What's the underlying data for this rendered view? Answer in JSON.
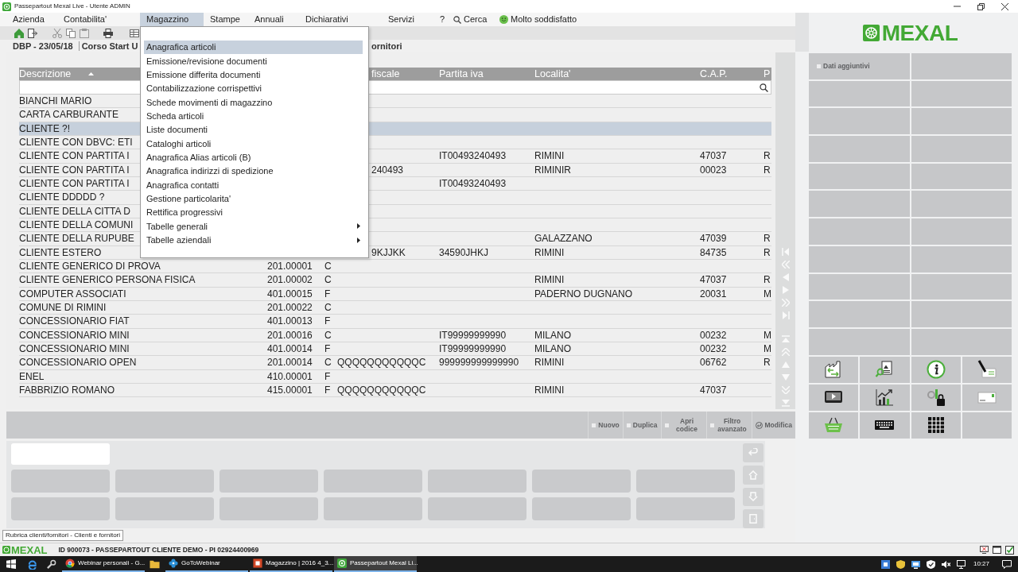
{
  "window": {
    "title": "Passepartout Mexal Live - Utente ADMIN"
  },
  "menu_bar": [
    {
      "label": "Azienda",
      "kind": "menu",
      "selected": false
    },
    {
      "label": "Contabilita'",
      "kind": "menu",
      "selected": false
    },
    {
      "label": "Magazzino",
      "kind": "menu",
      "selected": true
    },
    {
      "label": "Stampe",
      "kind": "menu",
      "selected": false
    },
    {
      "label": "Annuali",
      "kind": "menu",
      "selected": false
    },
    {
      "label": "Dichiarativi",
      "kind": "menu",
      "selected": false
    },
    {
      "label": "Servizi",
      "kind": "menu",
      "selected": false
    },
    {
      "label": "?",
      "kind": "menu",
      "selected": false
    },
    {
      "label": "Cerca",
      "kind": "search",
      "selected": false
    },
    {
      "label": "Molto soddisfatto",
      "kind": "feedback",
      "selected": false
    }
  ],
  "breadcrumb": {
    "context": "DBP - 23/05/18",
    "title_left_part": "Corso Start U",
    "title_right_part": "ornitori"
  },
  "table": {
    "columns": {
      "descrizione": {
        "label": "Descrizione",
        "sort_ascending": true
      },
      "fiscale": {
        "label": "fiscale"
      },
      "partita_iva": {
        "label": "Partita iva"
      },
      "localita": {
        "label": "Localita'"
      },
      "cap": {
        "label": "C.A.P."
      },
      "column_8": {
        "label": "P"
      }
    },
    "rows": [
      {
        "descrizione": "BIANCHI MARIO",
        "selected": false
      },
      {
        "descrizione": "CARTA CARBURANTE",
        "selected": false
      },
      {
        "descrizione": "CLIENTE ?!",
        "selected": true
      },
      {
        "descrizione": "CLIENTE CON DBVC: ETI",
        "selected": false
      },
      {
        "descrizione": "CLIENTE CON PARTITA I",
        "partita_iva": "IT00493240493",
        "localita": "RIMINI",
        "cap": "47037",
        "column_8": "R",
        "selected": false
      },
      {
        "descrizione": "CLIENTE CON PARTITA I",
        "fiscale": "240493",
        "localita": "RIMINIR",
        "cap": "00023",
        "column_8": "R",
        "selected": false
      },
      {
        "descrizione": "CLIENTE CON PARTITA I",
        "partita_iva": "IT00493240493",
        "selected": false
      },
      {
        "descrizione": "CLIENTE DDDDD ?",
        "selected": false
      },
      {
        "descrizione": "CLIENTE DELLA CITTA D",
        "selected": false
      },
      {
        "descrizione": "CLIENTE DELLA COMUNI",
        "selected": false
      },
      {
        "descrizione": "CLIENTE DELLA RUPUBE",
        "localita": "GALAZZANO",
        "cap": "47039",
        "column_8": "R",
        "selected": false
      },
      {
        "descrizione": "CLIENTE ESTERO",
        "fiscale": "9KJJKK",
        "partita_iva": "34590JHKJ",
        "localita": "RIMINI",
        "cap": "84735",
        "column_8": "R",
        "selected": false
      },
      {
        "descrizione": "CLIENTE GENERICO DI PROVA",
        "column_2": "201.00001",
        "column_3": "C",
        "selected": false
      },
      {
        "descrizione": "CLIENTE GENERICO PERSONA FISICA",
        "column_2": "201.00002",
        "column_3": "C",
        "localita": "RIMINI",
        "cap": "47037",
        "column_8": "R",
        "selected": false
      },
      {
        "descrizione": "COMPUTER ASSOCIATI",
        "column_2": "401.00015",
        "column_3": "F",
        "localita": "PADERNO DUGNANO",
        "cap": "20031",
        "column_8": "M",
        "selected": false
      },
      {
        "descrizione": "COMUNE DI RIMINI",
        "column_2": "201.00022",
        "column_3": "C",
        "selected": false
      },
      {
        "descrizione": "CONCESSIONARIO FIAT",
        "column_2": "401.00013",
        "column_3": "F",
        "selected": false
      },
      {
        "descrizione": "CONCESSIONARIO MINI",
        "column_2": "201.00016",
        "column_3": "C",
        "partita_iva": "IT99999999990",
        "localita": "MILANO",
        "cap": "00232",
        "column_8": "M",
        "selected": false
      },
      {
        "descrizione": "CONCESSIONARIO MINI",
        "column_2": "401.00014",
        "column_3": "F",
        "partita_iva": "IT99999999990",
        "localita": "MILANO",
        "cap": "00232",
        "column_8": "M",
        "selected": false
      },
      {
        "descrizione": "CONCESSIONARIO OPEN",
        "column_2": "201.00014",
        "column_3": "C",
        "fiscale": "QQQQQQQQQQQC",
        "partita_iva": "999999999999990",
        "localita": "RIMINI",
        "cap": "06762",
        "column_8": "R",
        "selected": false
      },
      {
        "descrizione": "ENEL",
        "column_2": "410.00001",
        "column_3": "F",
        "selected": false
      },
      {
        "descrizione": "FABBRIZIO ROMANO",
        "column_2": "415.00001",
        "column_3": "F",
        "fiscale": "QQQQQQQQQQQC",
        "localita": "RIMINI",
        "cap": "47037",
        "selected": false
      }
    ]
  },
  "dropdown_menu": {
    "items": [
      {
        "label": "Anagrafica articoli",
        "selected": true,
        "submenu": false
      },
      {
        "label": "Emissione/revisione documenti",
        "selected": false,
        "submenu": false
      },
      {
        "label": "Emissione differita documenti",
        "selected": false,
        "submenu": false
      },
      {
        "label": "Contabilizzazione corrispettivi",
        "selected": false,
        "submenu": false
      },
      {
        "label": "Schede movimenti di magazzino",
        "selected": false,
        "submenu": false
      },
      {
        "label": "Scheda articoli",
        "selected": false,
        "submenu": false
      },
      {
        "label": "Liste documenti",
        "selected": false,
        "submenu": false
      },
      {
        "label": "Cataloghi articoli",
        "selected": false,
        "submenu": false
      },
      {
        "label": "Anagrafica Alias articoli (B)",
        "selected": false,
        "submenu": false
      },
      {
        "label": "Anagrafica indirizzi di spedizione",
        "selected": false,
        "submenu": false
      },
      {
        "label": "Anagrafica contatti",
        "selected": false,
        "submenu": false
      },
      {
        "label": "Gestione particolarita'",
        "selected": false,
        "submenu": false
      },
      {
        "label": "Rettifica progressivi",
        "selected": false,
        "submenu": false
      },
      {
        "label": "Tabelle generali",
        "selected": false,
        "submenu": true
      },
      {
        "label": "Tabelle aziendali",
        "selected": false,
        "submenu": true
      }
    ]
  },
  "action_bar": {
    "buttons": [
      {
        "label": "Nuovo",
        "kind": "square",
        "disabled": true
      },
      {
        "label": "Duplica",
        "kind": "square",
        "disabled": true
      },
      {
        "label": "Apri codice",
        "kind": "square",
        "disabled": true
      },
      {
        "label": "Filtro avanzato",
        "kind": "square",
        "disabled": true
      },
      {
        "label": "Modifica",
        "kind": "return",
        "disabled": true
      }
    ]
  },
  "status_tooltip": "Rubrica clienti/fornitori - Clienti e fornitori",
  "side_panel": {
    "logo": "MEXAL",
    "buttons": [
      {
        "label": "Dati aggiuntivi",
        "disabled": true
      }
    ]
  },
  "status_bar": {
    "logo": "MEXAL",
    "text": "ID 900073 - PASSEPARTOUT CLIENTE DEMO - PI 02924400969"
  },
  "taskbar": {
    "items": [
      {
        "kind": "start",
        "selected": false
      },
      {
        "kind": "pinned",
        "selected": false
      },
      {
        "kind": "pinned",
        "selected": false
      },
      {
        "kind": "window",
        "label": "Webinar personali - G...",
        "selected": false
      },
      {
        "kind": "pinned",
        "selected": false
      },
      {
        "kind": "window",
        "label": "GoToWebinar",
        "selected": false
      },
      {
        "kind": "window",
        "label": "Magazzino | 2016 4_3....",
        "selected": false
      },
      {
        "kind": "window",
        "label": "Passepartout Mexal Li...",
        "selected": true
      }
    ],
    "clock": "10:27"
  }
}
